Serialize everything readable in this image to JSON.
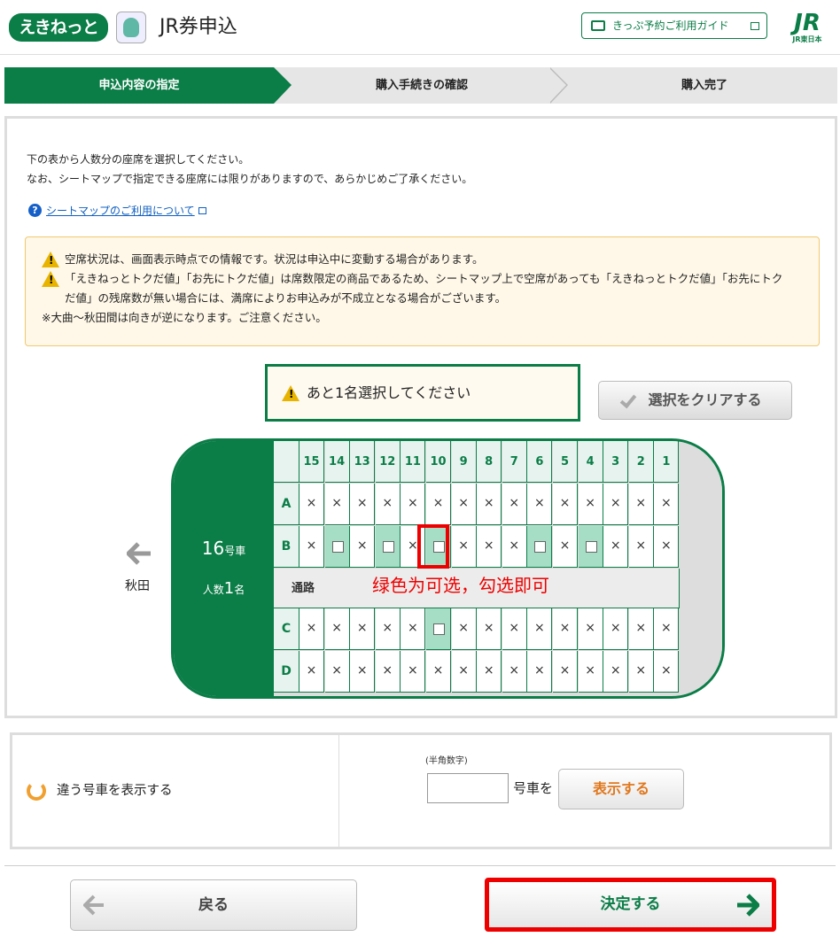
{
  "header": {
    "logo_text": "えきねっと",
    "mascot_icon": "train-mascot-icon",
    "title": "JR券申込",
    "guide_label": "きっぷ予約ご利用ガイド",
    "jr_logo": "JR",
    "jr_sub": "JR東日本"
  },
  "steps": [
    {
      "label": "申込内容の指定",
      "active": true
    },
    {
      "label": "購入手続きの確認",
      "active": false
    },
    {
      "label": "購入完了",
      "active": false
    }
  ],
  "intro": {
    "line1": "下の表から人数分の座席を選択してください。",
    "line2": "なお、シートマップで指定できる座席には限りがありますので、あらかじめご了承ください。",
    "help_link": "シートマップのご利用について"
  },
  "notice": {
    "line1": "空席状況は、画面表示時点での情報です。状況は申込中に変動する場合があります。",
    "line2a": "「えきねっとトクだ値」「お先にトクだ値」は席数限定の商品であるため、シートマップ上で空席があっても「えきねっとトクだ値」「お先にトク",
    "line2b": "だ値」の残席数が無い場合には、満席によりお申込みが不成立となる場合がございます。",
    "line3": "※大曲～秋田間は向きが逆になります。ご注意ください。"
  },
  "remain_text": "あと1名選択してください",
  "clear_button": "選択をクリアする",
  "car": {
    "number": "16",
    "number_suffix": "号車",
    "pax_label": "人数",
    "pax_count": "1",
    "pax_suffix": "名",
    "aisle_label": "通路",
    "direction_label": "秋田",
    "columns": [
      "15",
      "14",
      "13",
      "12",
      "11",
      "10",
      "9",
      "8",
      "7",
      "6",
      "5",
      "4",
      "3",
      "2",
      "1"
    ],
    "rows": [
      {
        "label": "A",
        "seats": [
          "x",
          "x",
          "x",
          "x",
          "x",
          "x",
          "x",
          "x",
          "x",
          "x",
          "x",
          "x",
          "x",
          "x",
          "x"
        ]
      },
      {
        "label": "B",
        "seats": [
          "x",
          "o",
          "x",
          "o",
          "x",
          "o",
          "x",
          "x",
          "x",
          "o",
          "x",
          "o",
          "x",
          "x",
          "x"
        ]
      },
      {
        "label": "C",
        "seats": [
          "x",
          "x",
          "x",
          "x",
          "x",
          "o",
          "x",
          "x",
          "x",
          "x",
          "x",
          "x",
          "x",
          "x",
          "x"
        ]
      },
      {
        "label": "D",
        "seats": [
          "x",
          "x",
          "x",
          "x",
          "x",
          "x",
          "x",
          "x",
          "x",
          "x",
          "x",
          "x",
          "x",
          "x",
          "x"
        ]
      }
    ],
    "unavailable_mark": "×"
  },
  "annotation": "绿色为可选，勾选即可",
  "other_car": {
    "label": "違う号車を表示する",
    "half_width_note": "(半角数字)",
    "input_value": "",
    "suffix": "号車を",
    "show_button": "表示する"
  },
  "footer": {
    "back_button": "戻る",
    "confirm_button": "決定する"
  },
  "colors": {
    "brand_green": "#0b7d47",
    "available_seat": "#a6ddc5",
    "annotation_red": "#e00000",
    "show_button_text": "#e0781e"
  }
}
